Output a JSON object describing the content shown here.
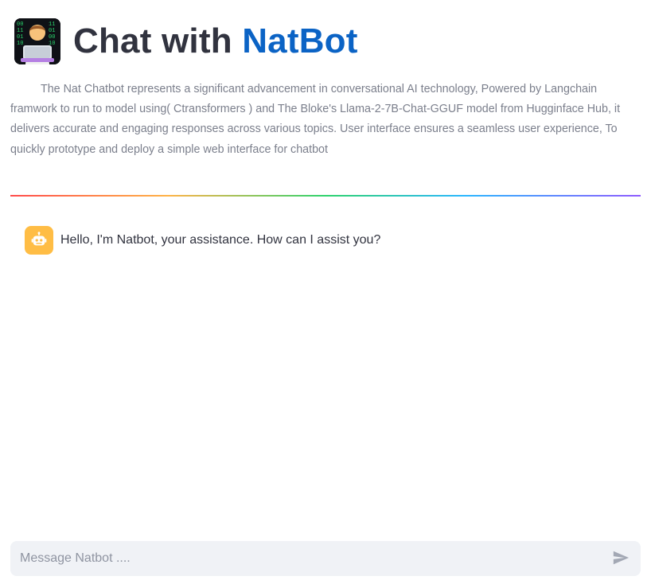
{
  "header": {
    "title_prefix": "Chat with ",
    "title_brand": "NatBot",
    "logo_icon": "technologist-icon"
  },
  "description": "The Nat Chatbot represents a significant advancement in conversational AI technology, Powered by Langchain framwork to run to model using( Ctransformers ) and The Bloke's Llama-2-7B-Chat-GGUF model from Hugginface Hub, it delivers accurate and engaging responses across various topics. User interface ensures a seamless user experience, To quickly prototype and deploy a simple web interface for chatbot",
  "chat": {
    "messages": [
      {
        "role": "assistant",
        "avatar_icon": "bot-icon",
        "text": "Hello, I'm Natbot, your assistance. How can I assist you?"
      }
    ]
  },
  "input": {
    "placeholder": "Message Natbot ....",
    "value": "",
    "send_icon": "send-icon"
  },
  "colors": {
    "brand_blue": "#0b63c5",
    "title_dark": "#31333f",
    "bot_avatar_bg": "#ffbd45",
    "input_bg": "#f0f2f6"
  }
}
